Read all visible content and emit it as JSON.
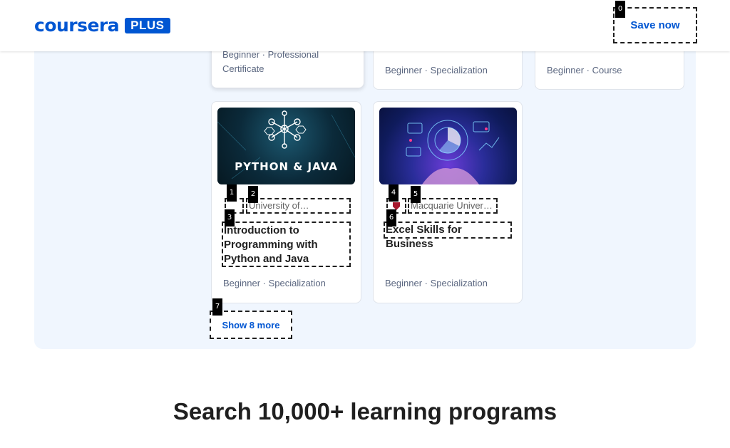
{
  "header": {
    "logo_word": "coursera",
    "logo_plus": "PLUS",
    "save_button": "Save now",
    "brand_color": "#0056d2"
  },
  "cards_top": [
    {
      "meta": "Beginner · Professional Certificate"
    },
    {
      "meta": "Beginner · Specialization"
    },
    {
      "meta": "Beginner · Course"
    }
  ],
  "cards": [
    {
      "thumb_text": "PYTHON & JAVA",
      "partner_name": "University of…",
      "title": "Introduction to Programming with Python and Java",
      "meta": "Beginner · Specialization"
    },
    {
      "partner_name": "Macquarie University",
      "title": "Excel Skills for Business",
      "meta": "Beginner · Specialization"
    }
  ],
  "show_more": "Show 8 more",
  "search_heading": "Search 10,000+ learning programs",
  "tags": [
    "0",
    "1",
    "2",
    "3",
    "4",
    "5",
    "6",
    "7"
  ]
}
